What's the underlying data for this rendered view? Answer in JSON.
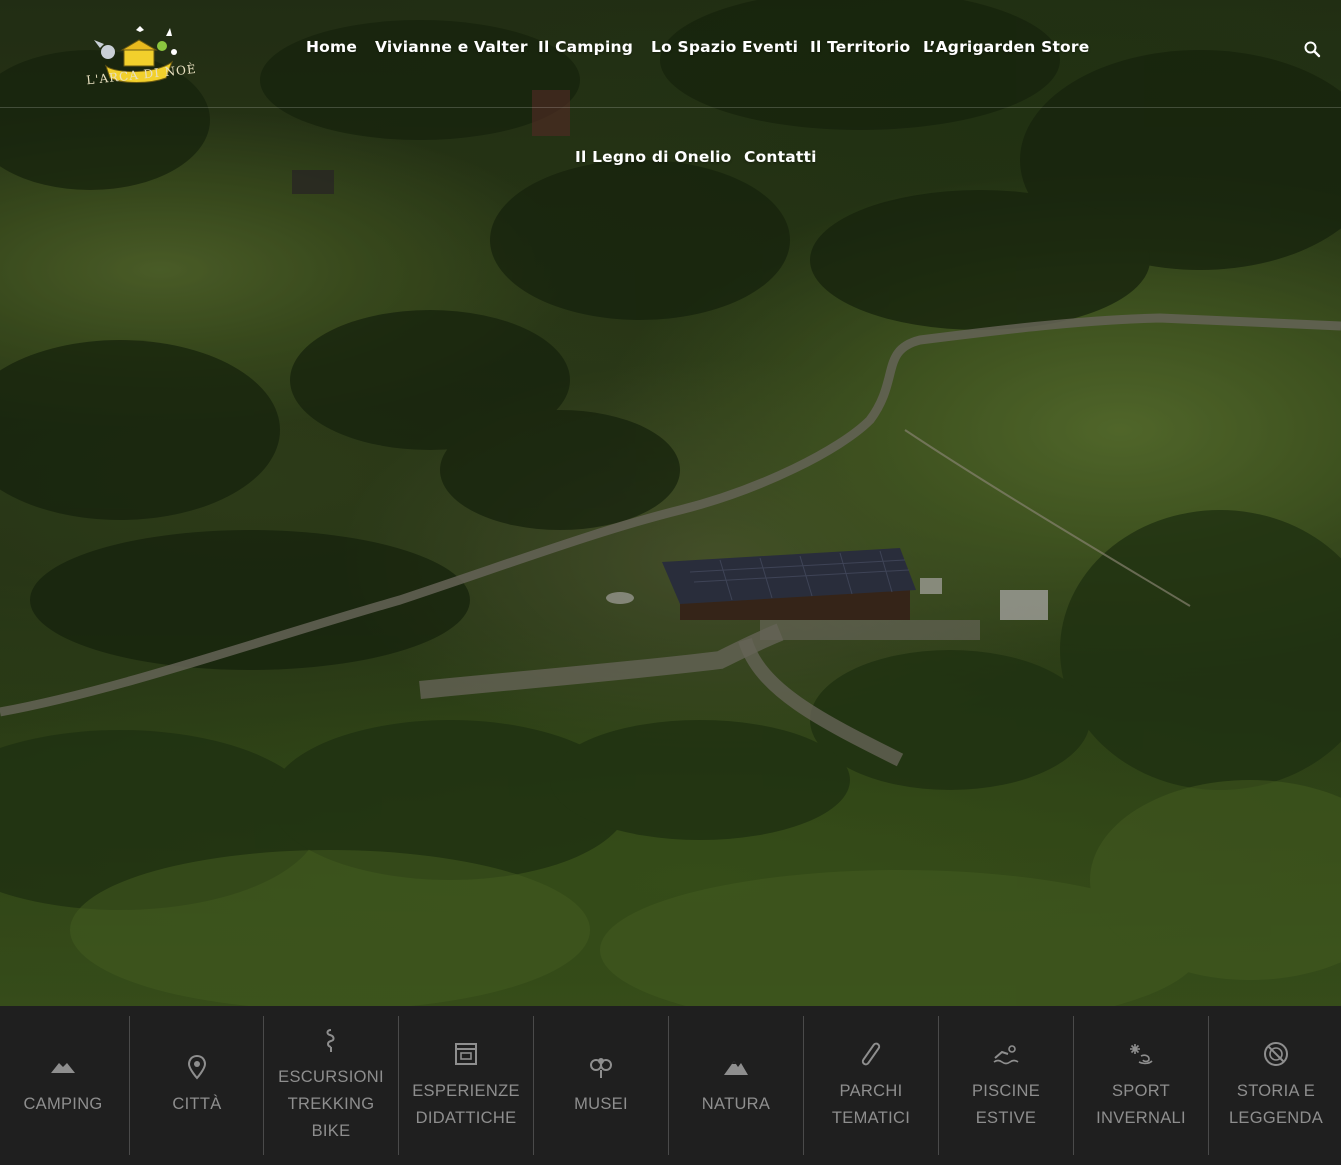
{
  "header": {
    "logo_text": "L'ARCA DI NOÈ",
    "nav": [
      {
        "label": "Home"
      },
      {
        "label": "Vivianne e Valter"
      },
      {
        "label": "Il Camping"
      },
      {
        "label": "Lo Spazio Eventi"
      },
      {
        "label": "Il Territorio"
      },
      {
        "label": "L’Agrigarden Store"
      },
      {
        "label": "Il Legno di Onelio"
      },
      {
        "label": "Contatti"
      }
    ],
    "search_icon": "search-icon"
  },
  "categories": [
    {
      "label": "CAMPING",
      "icon": "tent-icon"
    },
    {
      "label": "CITTÀ",
      "icon": "map-pin-icon"
    },
    {
      "label": "ESCURSIONI\nTREKKING\nBIKE",
      "icon": "signpost-icon"
    },
    {
      "label": "ESPERIENZE\nDIDATTICHE",
      "icon": "building-icon"
    },
    {
      "label": "MUSEI",
      "icon": "vase-icon"
    },
    {
      "label": "NATURA",
      "icon": "mountain-icon"
    },
    {
      "label": "PARCHI\nTEMATICI",
      "icon": "climbing-icon"
    },
    {
      "label": "PISCINE\nESTIVE",
      "icon": "swimmer-icon"
    },
    {
      "label": "SPORT\nINVERNALI",
      "icon": "skier-icon"
    },
    {
      "label": "STORIA E\nLEGGENDA",
      "icon": "shield-icon"
    }
  ],
  "colors": {
    "nav_text": "#ffffff",
    "bar_background": "#1f1f1f",
    "bar_text": "#8e8e8e",
    "logo_accent": "#f2d02c"
  }
}
